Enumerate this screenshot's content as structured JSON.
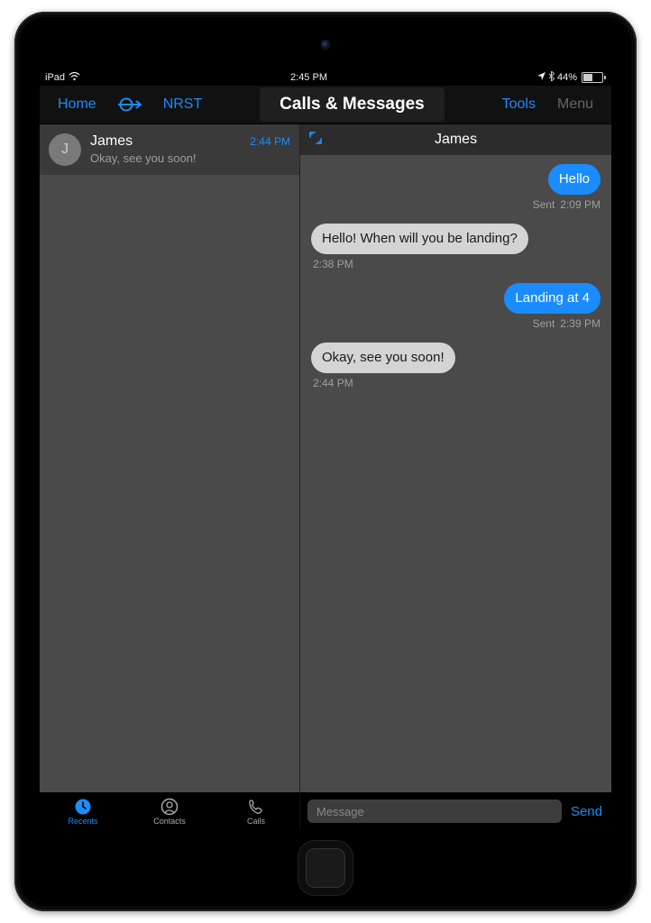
{
  "status": {
    "device": "iPad",
    "time": "2:45 PM",
    "battery_pct": "44%"
  },
  "nav": {
    "home": "Home",
    "nrst": "NRST",
    "title": "Calls & Messages",
    "tools": "Tools",
    "menu": "Menu"
  },
  "threads": [
    {
      "initial": "J",
      "name": "James",
      "time": "2:44 PM",
      "preview": "Okay, see you soon!"
    }
  ],
  "conversation": {
    "title": "James",
    "messages": [
      {
        "dir": "sent",
        "text": "Hello",
        "status": "Sent",
        "time": "2:09 PM"
      },
      {
        "dir": "received",
        "text": "Hello! When will you be landing?",
        "status": "",
        "time": "2:38 PM"
      },
      {
        "dir": "sent",
        "text": "Landing at 4",
        "status": "Sent",
        "time": "2:39 PM"
      },
      {
        "dir": "received",
        "text": "Okay, see you soon!",
        "status": "",
        "time": "2:44 PM"
      }
    ]
  },
  "tabs": {
    "recents": "Recents",
    "contacts": "Contacts",
    "calls": "Calls"
  },
  "compose": {
    "placeholder": "Message",
    "send": "Send"
  }
}
